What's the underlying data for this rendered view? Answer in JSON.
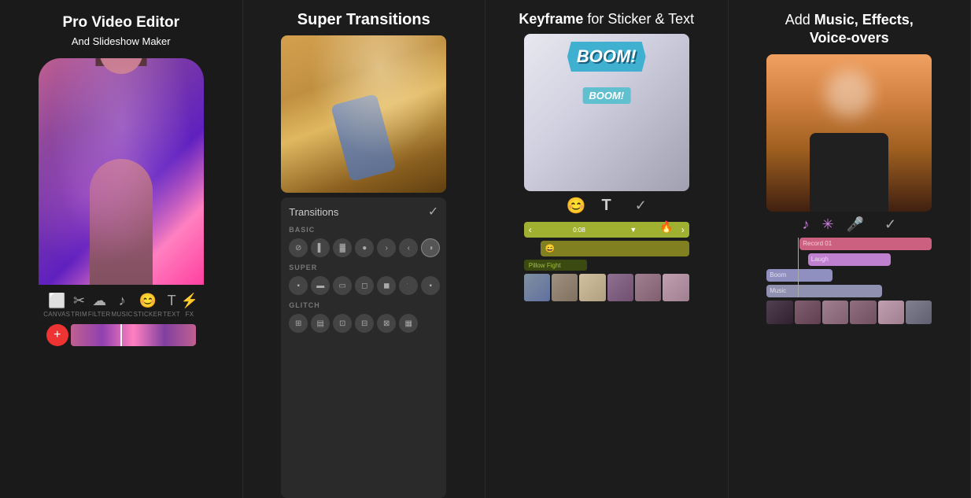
{
  "panel1": {
    "title_line1": "Pro Video Editor",
    "title_line2": "And Slideshow Maker",
    "toolbar": {
      "items": [
        {
          "icon": "🎬",
          "label": "CANVAS"
        },
        {
          "icon": "✂️",
          "label": "TRIM"
        },
        {
          "icon": "🎛️",
          "label": "FILTER"
        },
        {
          "icon": "🎵",
          "label": "MUSIC"
        },
        {
          "icon": "😊",
          "label": "STICKER"
        },
        {
          "icon": "T",
          "label": "TEXT"
        },
        {
          "icon": "✦",
          "label": "FX"
        }
      ]
    },
    "add_button": "+"
  },
  "panel2": {
    "title": "Super Transitions",
    "transitions_label": "Transitions",
    "check": "✓",
    "sections": [
      {
        "label": "BASIC",
        "count": 7
      },
      {
        "label": "SUPER",
        "count": 7
      },
      {
        "label": "GLITCH",
        "count": 6
      }
    ]
  },
  "panel3": {
    "title_regular": "for Sticker & Text",
    "title_bold": "Keyframe",
    "boom_text": "BOOM!",
    "boom_text2": "BOOM!",
    "tracks": [
      {
        "label": "Pillow Fight",
        "color": "olive"
      },
      {
        "label": "",
        "color": "yellow-green"
      }
    ]
  },
  "panel4": {
    "title_line1": "Add",
    "title_bold1": "Music, Effects,",
    "title_bold2": "Voice-overs",
    "tracks": [
      {
        "label": "Record 01",
        "type": "record"
      },
      {
        "label": "Laugh",
        "type": "laugh"
      },
      {
        "label": "Boom",
        "type": "boom"
      },
      {
        "label": "Music",
        "type": "music"
      }
    ],
    "icons": {
      "music": "♪",
      "effects": "✳",
      "mic": "🎤"
    }
  }
}
